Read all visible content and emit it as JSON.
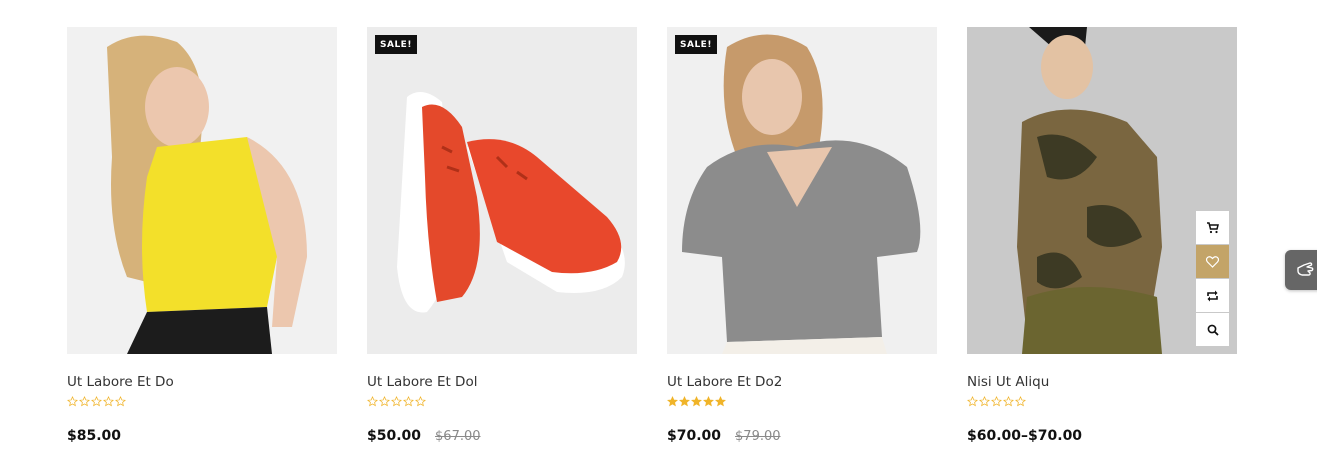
{
  "products": [
    {
      "title": "Ut Labore Et Do",
      "price": "$85.00",
      "old_price": "",
      "sale_badge": "",
      "rating": 0
    },
    {
      "title": "Ut Labore Et Dol",
      "price": "$50.00",
      "old_price": "$67.00",
      "sale_badge": "SALE!",
      "rating": 0
    },
    {
      "title": "Ut Labore Et Do2",
      "price": "$70.00",
      "old_price": "$79.00",
      "sale_badge": "SALE!",
      "rating": 5
    },
    {
      "title": "Nisi Ut Aliqu",
      "price": "$60.00–$70.00",
      "old_price": "",
      "sale_badge": "",
      "rating": 0
    }
  ],
  "colors": {
    "star": "#f0b429",
    "accent": "#c3a468",
    "badge_bg": "#111111"
  },
  "icons": {
    "cart": "cart-icon",
    "wishlist": "heart-icon",
    "compare": "compare-icon",
    "quickview": "search-icon",
    "floating": "hand-pointer-icon"
  }
}
